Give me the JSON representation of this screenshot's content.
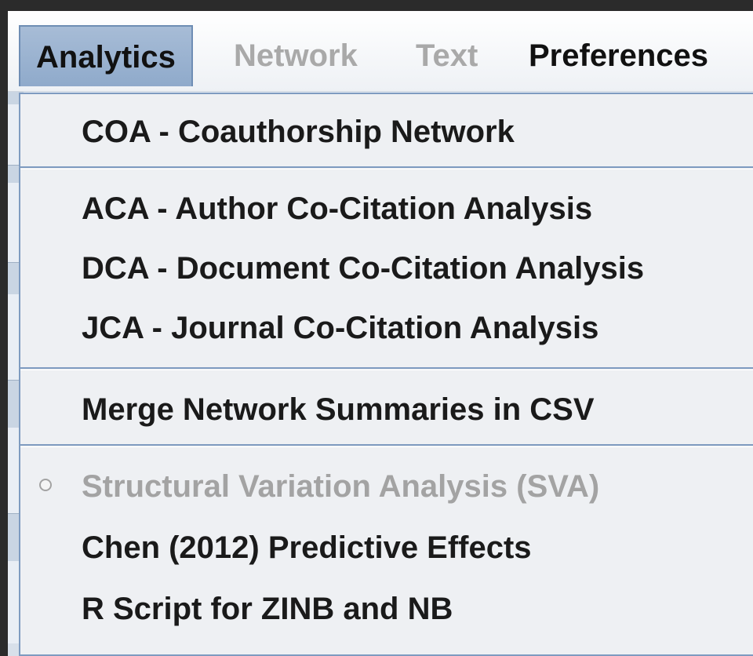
{
  "menubar": {
    "items": [
      {
        "label": "Analytics",
        "state": "active"
      },
      {
        "label": "Network",
        "state": "disabled"
      },
      {
        "label": "Text",
        "state": "disabled"
      },
      {
        "label": "Preferences",
        "state": "enabled"
      }
    ]
  },
  "dropdown": {
    "items": [
      {
        "label": "COA - Coauthorship Network",
        "enabled": true
      },
      {
        "label": "ACA - Author Co-Citation Analysis",
        "enabled": true
      },
      {
        "label": "DCA - Document Co-Citation Analysis",
        "enabled": true
      },
      {
        "label": "JCA - Journal Co-Citation Analysis",
        "enabled": true
      },
      {
        "label": "Merge Network Summaries in CSV",
        "enabled": true
      },
      {
        "label": "Structural Variation Analysis (SVA)",
        "enabled": false,
        "icon": "radio-unchecked-icon"
      },
      {
        "label": "Chen (2012) Predictive Effects",
        "enabled": true
      },
      {
        "label": "R Script for ZINB and NB",
        "enabled": true
      }
    ]
  },
  "colors": {
    "active_menu": "#8faacb",
    "separator": "#7e9bc0",
    "disabled_text": "#a3a3a3"
  }
}
